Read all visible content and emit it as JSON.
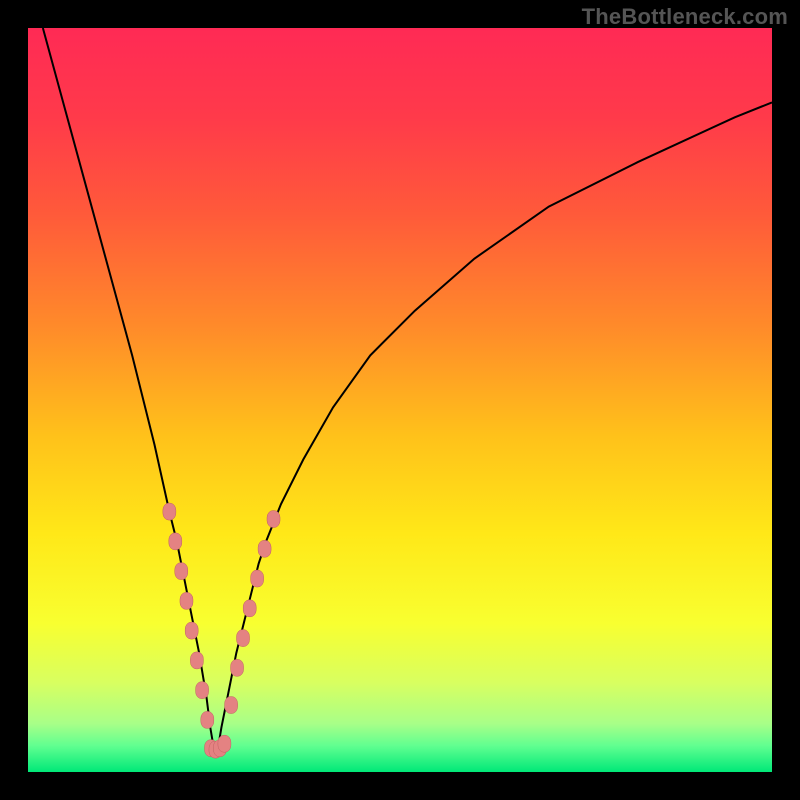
{
  "watermark": "TheBottleneck.com",
  "colors": {
    "frame": "#000000",
    "watermark_text": "#555555",
    "curve_stroke": "#000000",
    "dot_fill": "#e48282",
    "dot_stroke": "#c06262",
    "gradient_stops": [
      {
        "offset": 0.0,
        "color": "#ff2a55"
      },
      {
        "offset": 0.12,
        "color": "#ff3a4a"
      },
      {
        "offset": 0.25,
        "color": "#ff5a3a"
      },
      {
        "offset": 0.4,
        "color": "#ff8a2a"
      },
      {
        "offset": 0.55,
        "color": "#ffc21a"
      },
      {
        "offset": 0.68,
        "color": "#ffe818"
      },
      {
        "offset": 0.8,
        "color": "#f8ff30"
      },
      {
        "offset": 0.88,
        "color": "#d8ff60"
      },
      {
        "offset": 0.935,
        "color": "#a8ff88"
      },
      {
        "offset": 0.965,
        "color": "#60ff90"
      },
      {
        "offset": 1.0,
        "color": "#00e878"
      }
    ]
  },
  "chart_data": {
    "type": "line",
    "title": "",
    "xlabel": "",
    "ylabel": "",
    "xlim": [
      0,
      100
    ],
    "ylim": [
      0,
      100
    ],
    "series": [
      {
        "name": "bottleneck-curve",
        "description": "V-shaped bottleneck curve; y is bottleneck severity (0 = optimal, 100 = worst). Minimum at x≈25.",
        "x": [
          2,
          5,
          8,
          11,
          14,
          17,
          19,
          20,
          21,
          22,
          23,
          24,
          24.5,
          25,
          25.5,
          26,
          27,
          28,
          29,
          30,
          31,
          32,
          34,
          37,
          41,
          46,
          52,
          60,
          70,
          82,
          95,
          100
        ],
        "values": [
          100,
          89,
          78,
          67,
          56,
          44,
          35,
          31,
          26,
          21,
          16,
          10,
          6,
          3,
          3,
          6,
          11,
          16,
          20,
          24,
          28,
          31,
          36,
          42,
          49,
          56,
          62,
          69,
          76,
          82,
          88,
          90
        ]
      }
    ],
    "markers": {
      "description": "Salmon-pink rounded dots overlaid on the curve near the valley region.",
      "left_branch": [
        {
          "x": 19,
          "y": 35
        },
        {
          "x": 19.8,
          "y": 31
        },
        {
          "x": 20.6,
          "y": 27
        },
        {
          "x": 21.3,
          "y": 23
        },
        {
          "x": 22.0,
          "y": 19
        },
        {
          "x": 22.7,
          "y": 15
        },
        {
          "x": 23.4,
          "y": 11
        },
        {
          "x": 24.1,
          "y": 7
        }
      ],
      "valley_floor": [
        {
          "x": 24.6,
          "y": 3.2
        },
        {
          "x": 25.2,
          "y": 3
        },
        {
          "x": 25.8,
          "y": 3.2
        },
        {
          "x": 26.4,
          "y": 3.8
        }
      ],
      "right_branch": [
        {
          "x": 27.3,
          "y": 9
        },
        {
          "x": 28.1,
          "y": 14
        },
        {
          "x": 28.9,
          "y": 18
        },
        {
          "x": 29.8,
          "y": 22
        },
        {
          "x": 30.8,
          "y": 26
        },
        {
          "x": 31.8,
          "y": 30
        },
        {
          "x": 33.0,
          "y": 34
        }
      ]
    }
  }
}
